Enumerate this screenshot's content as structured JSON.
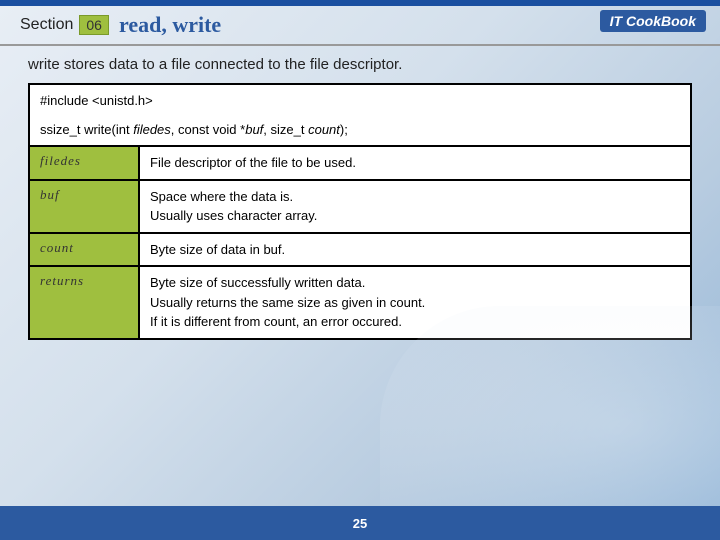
{
  "header": {
    "section_label": "Section",
    "section_number": "06",
    "title": "read, write",
    "brand": "IT CookBook"
  },
  "intro": "write stores data to a file connected to the file descriptor.",
  "code": {
    "include": "#include <unistd.h>",
    "signature_pre": "ssize_t write(int ",
    "signature_p1": "filedes",
    "signature_mid1": ", const void *",
    "signature_p2": "buf",
    "signature_mid2": ", size_t ",
    "signature_p3": "count",
    "signature_end": ");"
  },
  "params": [
    {
      "name": "filedes",
      "desc": "File descriptor of the file to be used."
    },
    {
      "name": "buf",
      "desc": "Space where the data is.\nUsually uses character array."
    },
    {
      "name": "count",
      "desc": "Byte size of data in buf."
    },
    {
      "name": "returns",
      "desc": "Byte size of successfully written data.\nUsually returns the same size as given in count.\nIf it is different from count, an error occured."
    }
  ],
  "footer": {
    "page": "25"
  }
}
